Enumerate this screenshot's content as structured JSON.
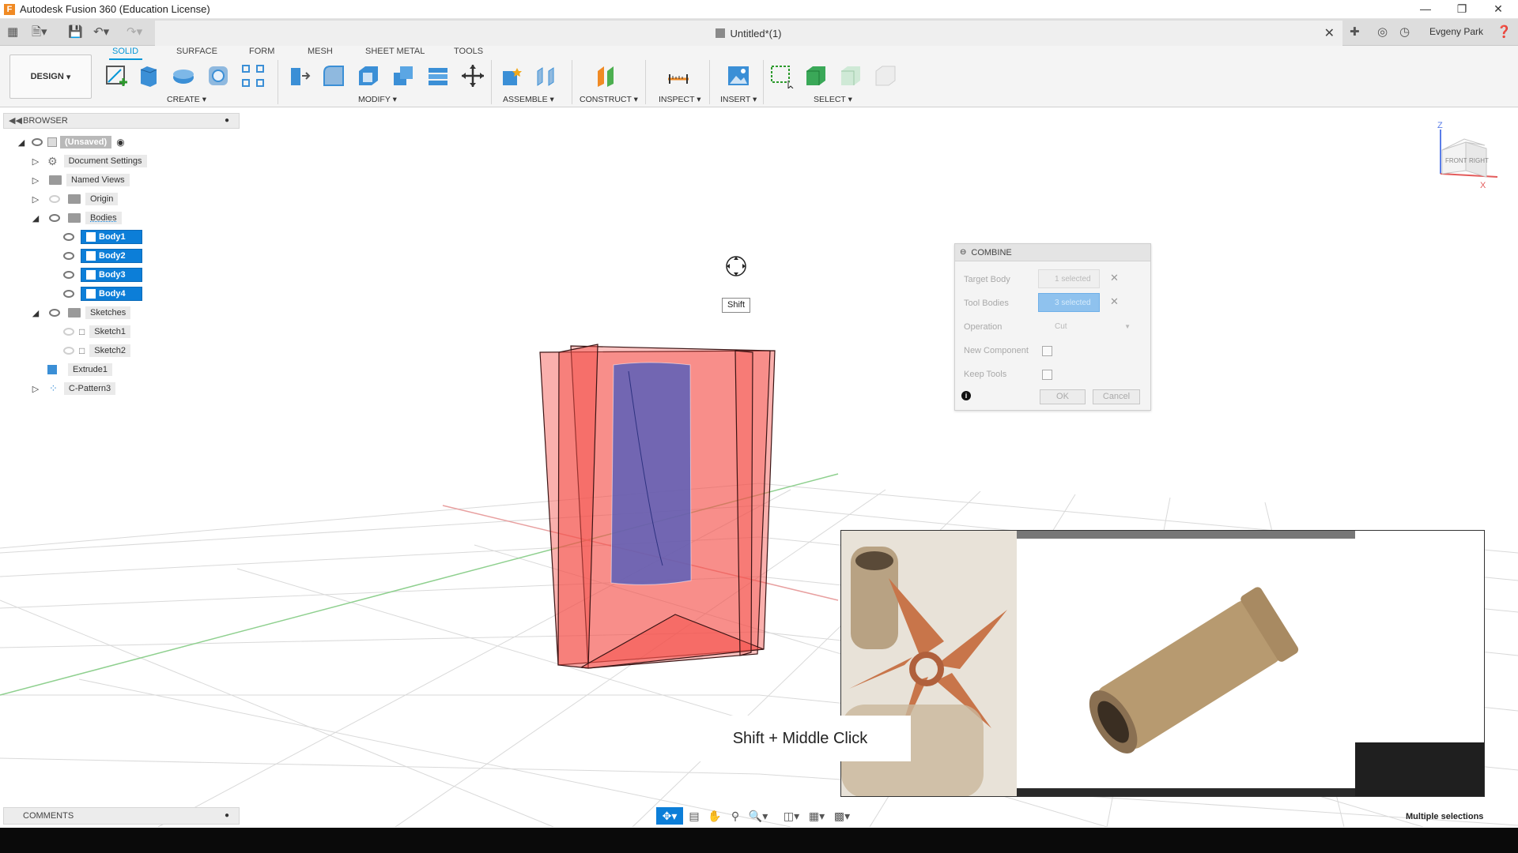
{
  "window": {
    "title": "Autodesk Fusion 360 (Education License)",
    "logo_letter": "F"
  },
  "tabbar": {
    "document_title": "Untitled*(1)",
    "user": "Evgeny Park"
  },
  "ribbon": {
    "workspace": "DESIGN",
    "tabs": [
      "SOLID",
      "SURFACE",
      "FORM",
      "MESH",
      "SHEET METAL",
      "TOOLS"
    ],
    "active_tab": "SOLID",
    "groups": [
      "CREATE",
      "MODIFY",
      "ASSEMBLE",
      "CONSTRUCT",
      "INSPECT",
      "INSERT",
      "SELECT"
    ]
  },
  "browser": {
    "title": "BROWSER",
    "root": "(Unsaved)",
    "items": [
      {
        "label": "Document Settings"
      },
      {
        "label": "Named Views"
      },
      {
        "label": "Origin"
      },
      {
        "label": "Bodies"
      },
      {
        "label": "Body1"
      },
      {
        "label": "Body2"
      },
      {
        "label": "Body3"
      },
      {
        "label": "Body4"
      },
      {
        "label": "Sketches"
      },
      {
        "label": "Sketch1"
      },
      {
        "label": "Sketch2"
      },
      {
        "label": "Extrude1"
      },
      {
        "label": "C-Pattern3"
      }
    ]
  },
  "combine_dialog": {
    "title": "COMBINE",
    "target_body_label": "Target Body",
    "target_body_value": "1 selected",
    "tool_bodies_label": "Tool Bodies",
    "tool_bodies_value": "3 selected",
    "operation_label": "Operation",
    "operation_value": "Cut",
    "new_component_label": "New Component",
    "keep_tools_label": "Keep Tools",
    "ok_label": "OK",
    "cancel_label": "Cancel"
  },
  "viewport": {
    "tooltip": "Shift",
    "caption": "Shift + Middle Click",
    "viewcube_front": "FRONT",
    "viewcube_right": "RIGHT",
    "axis_z": "Z",
    "axis_x": "X"
  },
  "comments": {
    "title": "COMMENTS"
  },
  "status": {
    "text": "Multiple selections"
  },
  "colors": {
    "accent": "#0696d7",
    "selection": "#0c7ed8",
    "body_red": "#f4504a",
    "body_blue": "#5b5fb8"
  }
}
